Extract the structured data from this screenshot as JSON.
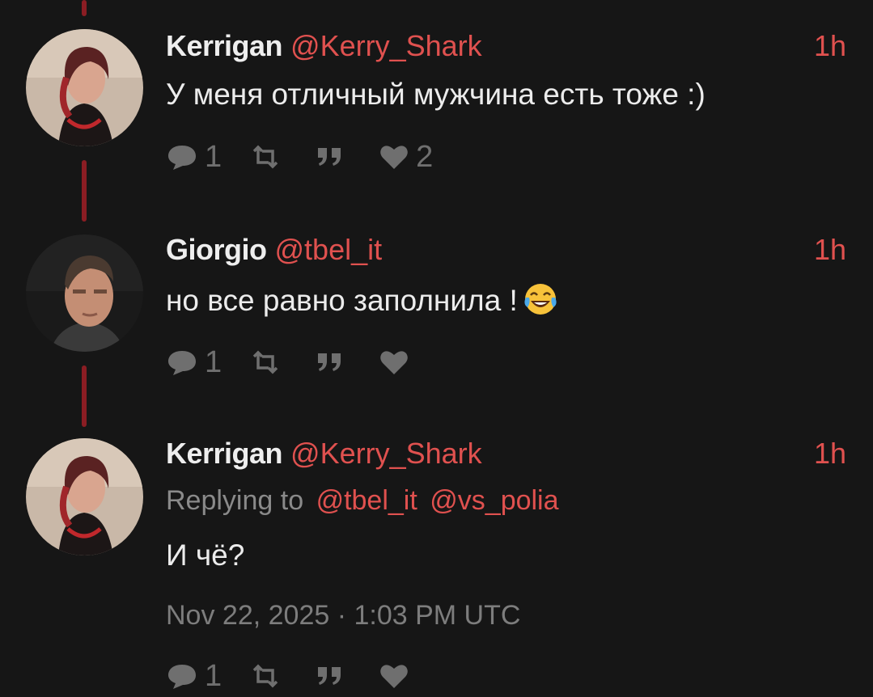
{
  "colors": {
    "background": "#161616",
    "accent": "#e0514f",
    "thread_line": "#8b1d23",
    "muted": "#6f6f6f"
  },
  "tweets": [
    {
      "name": "Kerrigan",
      "handle": "@Kerry_Shark",
      "time": "1h",
      "text": "У меня отличный мужчина есть тоже :)",
      "replies": "1",
      "retweets": "",
      "quotes": "",
      "likes": "2"
    },
    {
      "name": "Giorgio",
      "handle": "@tbel_it",
      "time": "1h",
      "text": "но все равно заполнила !",
      "emoji": "face-with-tears-of-joy-icon",
      "replies": "1",
      "retweets": "",
      "quotes": "",
      "likes": ""
    },
    {
      "name": "Kerrigan",
      "handle": "@Kerry_Shark",
      "time": "1h",
      "replying_label": "Replying to",
      "replying_to": [
        "@tbel_it",
        "@vs_polia"
      ],
      "text": "И чё?",
      "date": "Nov 22, 2025 · 1:03 PM UTC",
      "replies": "1",
      "retweets": "",
      "quotes": "",
      "likes": ""
    }
  ],
  "icons": {
    "reply": "comment-icon",
    "retweet": "retweet-icon",
    "quote": "quote-icon",
    "like": "heart-icon"
  }
}
